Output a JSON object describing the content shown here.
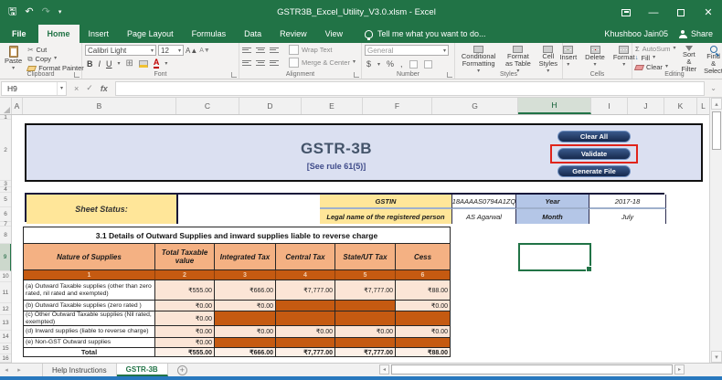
{
  "window": {
    "title": "GSTR3B_Excel_Utility_V3.0.xlsm - Excel",
    "user": "Khushboo Jain05",
    "share": "Share"
  },
  "tabs": {
    "file": "File",
    "items": [
      "Home",
      "Insert",
      "Page Layout",
      "Formulas",
      "Data",
      "Review",
      "View"
    ],
    "active": "Home",
    "tell_me": "Tell me what you want to do..."
  },
  "ribbon": {
    "clipboard": {
      "label": "Clipboard",
      "paste": "Paste",
      "cut": "Cut",
      "copy": "Copy",
      "format_painter": "Format Painter"
    },
    "font": {
      "label": "Font",
      "font_name": "Calibri Light",
      "font_size": "12",
      "bold": "B",
      "italic": "I",
      "underline": "U"
    },
    "alignment": {
      "label": "Alignment",
      "wrap_text": "Wrap Text",
      "merge_center": "Merge & Center"
    },
    "number": {
      "label": "Number",
      "format": "General",
      "currency": "$",
      "percent": "%",
      "comma": ","
    },
    "styles": {
      "label": "Styles",
      "conditional": "Conditional Formatting",
      "format_table": "Format as Table",
      "cell_styles": "Cell Styles"
    },
    "cells": {
      "label": "Cells",
      "insert": "Insert",
      "delete": "Delete",
      "format": "Format"
    },
    "editing": {
      "label": "Editing",
      "autosum": "AutoSum",
      "autosum_glyph": "Σ",
      "fill": "Fill",
      "clear": "Clear",
      "sort_filter": "Sort & Filter",
      "find_select": "Find & Select"
    }
  },
  "formula_bar": {
    "name_box": "H9",
    "fx": "fx"
  },
  "grid": {
    "columns": [
      "A",
      "B",
      "C",
      "D",
      "E",
      "F",
      "G",
      "H",
      "I",
      "J",
      "K",
      "L"
    ],
    "rows": [
      "1",
      "2",
      "3",
      "4",
      "5",
      "6",
      "7",
      "8",
      "9",
      "10",
      "11",
      "12",
      "13",
      "14",
      "15",
      "16"
    ],
    "active_cell": "H9"
  },
  "form": {
    "title": "GSTR-3B",
    "subtitle": "[See rule 61(5)]",
    "buttons": {
      "clear_all": "Clear All",
      "validate": "Validate",
      "generate": "Generate File"
    },
    "highlighted_button": "Validate",
    "gstin_label": "GSTIN",
    "gstin_value": "18AAAAS0794A1ZQ",
    "year_label": "Year",
    "year_value": "2017-18",
    "legal_label": "Legal name of the registered person",
    "legal_value": "AS Agarwal",
    "month_label": "Month",
    "month_value": "July",
    "status_label": "Sheet Status:"
  },
  "table31": {
    "caption": "3.1 Details of Outward Supplies and inward supplies liable to reverse charge",
    "headers": [
      "Nature of Supplies",
      "Total Taxable value",
      "Integrated Tax",
      "Central Tax",
      "State/UT Tax",
      "Cess"
    ],
    "col_numbers": [
      "1",
      "2",
      "3",
      "4",
      "5",
      "6"
    ],
    "rows": [
      {
        "label": "(a) Outward Taxable supplies  (other than zero rated, nil rated and exempted)",
        "values": [
          "₹555.00",
          "₹666.00",
          "₹7,777.00",
          "₹7,777.00",
          "₹88.00"
        ]
      },
      {
        "label": "(b) Outward Taxable supplies  (zero rated )",
        "values": [
          "₹0.00",
          "₹0.00",
          null,
          null,
          "₹0.00"
        ]
      },
      {
        "label": "(c) Other Outward Taxable  supplies (Nil rated, exempted)",
        "values": [
          "₹0.00",
          null,
          null,
          null,
          null
        ]
      },
      {
        "label": "(d) Inward supplies (liable to reverse charge)",
        "values": [
          "₹0.00",
          "₹0.00",
          "₹0.00",
          "₹0.00",
          "₹0.00"
        ]
      },
      {
        "label": "(e) Non-GST Outward supplies",
        "values": [
          "₹0.00",
          null,
          null,
          null,
          null
        ]
      },
      {
        "label": "Total",
        "values": [
          "₹555.00",
          "₹666.00",
          "₹7,777.00",
          "₹7,777.00",
          "₹88.00"
        ]
      }
    ]
  },
  "sheet_tabs": {
    "help": "Help Instructions",
    "gstr": "GSTR-3B",
    "active": "GSTR-3B"
  },
  "icons": {
    "save": "🖫",
    "undo": "↶",
    "redo": "↷",
    "caret": "▾",
    "min": "—",
    "close": "✕",
    "cut": "✂",
    "copy": "⧉",
    "borders": "⊞",
    "grow": "A▲",
    "shrink": "A▼",
    "cancel": "×",
    "enter": "✓",
    "left": "◂",
    "right": "▸",
    "up": "▴",
    "down": "▾",
    "plus": "+",
    "chev_up": "⌃",
    "chev_down": "⌄",
    "fill_down": "↓",
    "sort_az": "A↓Z"
  },
  "colors": {
    "excel_green": "#217346",
    "header_fill": "#dbe0f1",
    "button_navy": "#1f3864",
    "highlight_red": "#e0241b",
    "label_yellow": "#ffe699",
    "label_blue": "#b4c6e7",
    "table_header": "#f4b183",
    "table_dark": "#c55a11",
    "cell_peach": "#fbe5d6",
    "taskbar_blue": "#2878be"
  }
}
